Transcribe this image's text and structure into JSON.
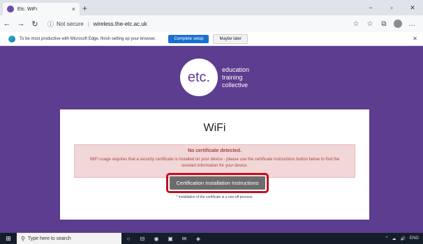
{
  "browser": {
    "tab_title": "Etc. WiFi",
    "tab_close": "×",
    "new_tab": "+",
    "window_min": "−",
    "window_max": "▫",
    "window_close": "✕",
    "nav_back": "←",
    "nav_forward": "→",
    "nav_refresh": "↻",
    "security_label": "Not secure",
    "url": "wireless.the-etc.ac.uk",
    "toolbar_icons": [
      "☆",
      "☆",
      "⧉"
    ],
    "menu": "…"
  },
  "infobar": {
    "text": "To be most productive with Microsoft Edge, finish setting up your browser.",
    "primary_button": "Complete setup",
    "secondary_button": "Maybe later",
    "close": "✕"
  },
  "page": {
    "logo_mark": "etc.",
    "logo_lines": [
      "education",
      "training",
      "collective"
    ],
    "title": "WiFi",
    "alert_heading": "No certificate detected.",
    "alert_body": "WiFi usage requires that a security certificate is installed on your device - please use the certificate instructions button below to find the revelant information for your device.",
    "install_button": "Certification Installation Instructions",
    "footnote": "* Installation of the certificate is a one-off process."
  },
  "taskbar": {
    "search_placeholder": "Type here to search",
    "icons": [
      "○",
      "⊟",
      "◉",
      "▣",
      "✉",
      "◈"
    ],
    "tray": [
      "^",
      "☁",
      "🔊",
      "ENG"
    ]
  },
  "colors": {
    "brand_purple": "#5c3d8f",
    "alert_bg": "#f2d7d8",
    "alert_text": "#a94442",
    "highlight": "#c0111f",
    "primary_blue": "#1a6fd1"
  }
}
